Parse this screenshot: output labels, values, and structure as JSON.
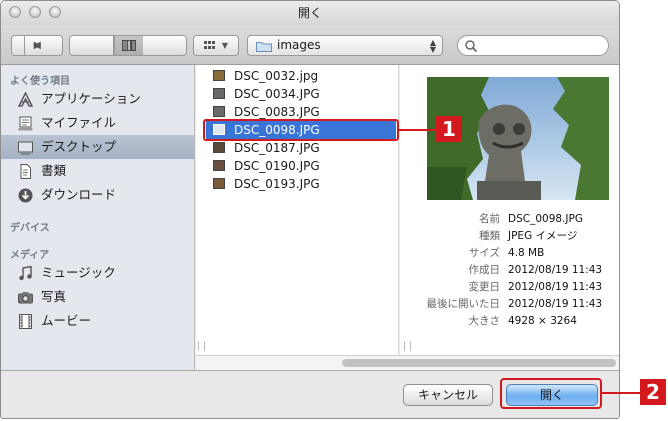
{
  "window": {
    "title": "開く"
  },
  "toolbar": {
    "path_folder": "images",
    "search_placeholder": ""
  },
  "sidebar": {
    "sections": [
      {
        "label": "よく使う項目",
        "items": [
          {
            "label": "アプリケーション",
            "icon": "applications-icon"
          },
          {
            "label": "マイファイル",
            "icon": "all-my-files-icon"
          },
          {
            "label": "デスクトップ",
            "icon": "desktop-icon",
            "selected": true
          },
          {
            "label": "書類",
            "icon": "documents-icon"
          },
          {
            "label": "ダウンロード",
            "icon": "downloads-icon"
          }
        ]
      },
      {
        "label": "デバイス",
        "items": []
      },
      {
        "label": "メディア",
        "items": [
          {
            "label": "ミュージック",
            "icon": "music-icon"
          },
          {
            "label": "写真",
            "icon": "camera-icon"
          },
          {
            "label": "ムービー",
            "icon": "film-icon"
          }
        ]
      }
    ]
  },
  "files": [
    {
      "name": "DSC_0032.jpg"
    },
    {
      "name": "DSC_0034.JPG"
    },
    {
      "name": "DSC_0083.JPG"
    },
    {
      "name": "DSC_0098.JPG",
      "selected": true
    },
    {
      "name": "DSC_0187.JPG"
    },
    {
      "name": "DSC_0190.JPG"
    },
    {
      "name": "DSC_0193.JPG"
    }
  ],
  "preview": {
    "rows": [
      {
        "key": "名前",
        "value": "DSC_0098.JPG"
      },
      {
        "key": "種類",
        "value": "JPEG イメージ"
      },
      {
        "key": "サイズ",
        "value": "4.8 MB"
      },
      {
        "key": "作成日",
        "value": "2012/08/19 11:43"
      },
      {
        "key": "変更日",
        "value": "2012/08/19 11:43"
      },
      {
        "key": "最後に開いた日",
        "value": "2012/08/19 11:43"
      },
      {
        "key": "大きさ",
        "value": "4928 × 3264"
      }
    ]
  },
  "buttons": {
    "cancel": "キャンセル",
    "open": "開く"
  },
  "callouts": [
    "1",
    "2"
  ],
  "colors": {
    "selection": "#3875d7",
    "callout": "#d3181e",
    "default_button": "#6db0f0"
  }
}
